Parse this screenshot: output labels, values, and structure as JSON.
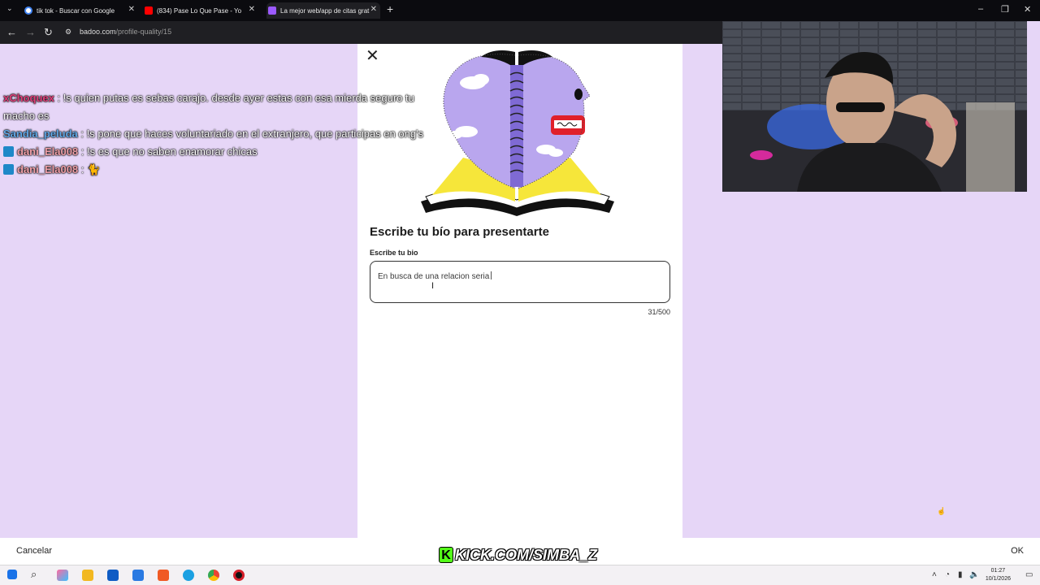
{
  "browser": {
    "tabs": [
      {
        "title": "tik tok - Buscar con Google",
        "favicon_color": "#4285f4"
      },
      {
        "title": "(834) Pase Lo Que Pase - Yo",
        "favicon_color": "#ff0000"
      },
      {
        "title": "La mejor web/app de citas grat",
        "favicon_color": "#9b59ff"
      }
    ],
    "url_domain": "badoo.com",
    "url_path": "/profile-quality/15"
  },
  "modal": {
    "title": "Escribe tu bío para presentarte",
    "field_label": "Escribe tu bio",
    "bio_value": "En busca de una relacion seria",
    "counter": "31/500"
  },
  "bottom_bar": {
    "cancel_label": "Cancelar",
    "ok_label": "OK"
  },
  "overlay": {
    "chat": [
      {
        "user": "xChoquex",
        "user_color": "#e0407a",
        "text": ": !s quien putas es sebas carajo. desde ayer estas con esa mierda seguro tu macho es",
        "badge": false
      },
      {
        "user": "Sandia_peluda",
        "user_color": "#62a9e8",
        "text": ": !s pone que haces voluntariado en el extranjero, que participas en ong's",
        "badge": false
      },
      {
        "user": "dani_Ela008",
        "user_color": "#f0a0a8",
        "text": ": !s es que no saben enamorar chicas",
        "badge": true
      },
      {
        "user": "dani_Ela008",
        "user_color": "#f0a0a8",
        "text": ": 🐈",
        "badge": true
      }
    ],
    "kick_label": "KICK.COM/SIMBA_Z"
  },
  "taskbar": {
    "time": "01:27",
    "date": "10/1/2026"
  }
}
